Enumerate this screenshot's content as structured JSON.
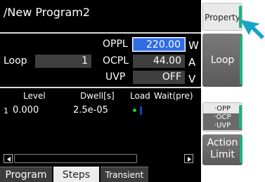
{
  "title": "/New Program2",
  "params": {
    "loop_label": "Loop",
    "loop_value": "1",
    "oppl_label": "OPPL",
    "oppl_value": "220.00",
    "oppl_unit": "W",
    "ocpl_label": "OCPL",
    "ocpl_value": "44.00",
    "ocpl_unit": "A",
    "uvp_label": "UVP",
    "uvp_value": "OFF",
    "uvp_unit": "V"
  },
  "table": {
    "headers": [
      "Level",
      "Dwell[s]",
      "Load",
      "Wait(pre)"
    ],
    "rows": [
      {
        "index": "1",
        "level": "0.000",
        "dwell": "2.5e-05",
        "load": "on",
        "wait": ""
      }
    ]
  },
  "tabs": [
    "Program",
    "Steps",
    "Transient"
  ],
  "active_tab": "Steps",
  "side": {
    "property": "Property",
    "loop": "Loop",
    "protect": [
      "·OPP",
      "·OCP",
      "·UVP"
    ],
    "action_limit_1": "Action",
    "action_limit_2": "Limit"
  },
  "colors": {
    "selected_field": "#2f6de0",
    "accent": "#19b37f",
    "cursor": "#1aa3c8",
    "load_on": "#22cc22"
  }
}
